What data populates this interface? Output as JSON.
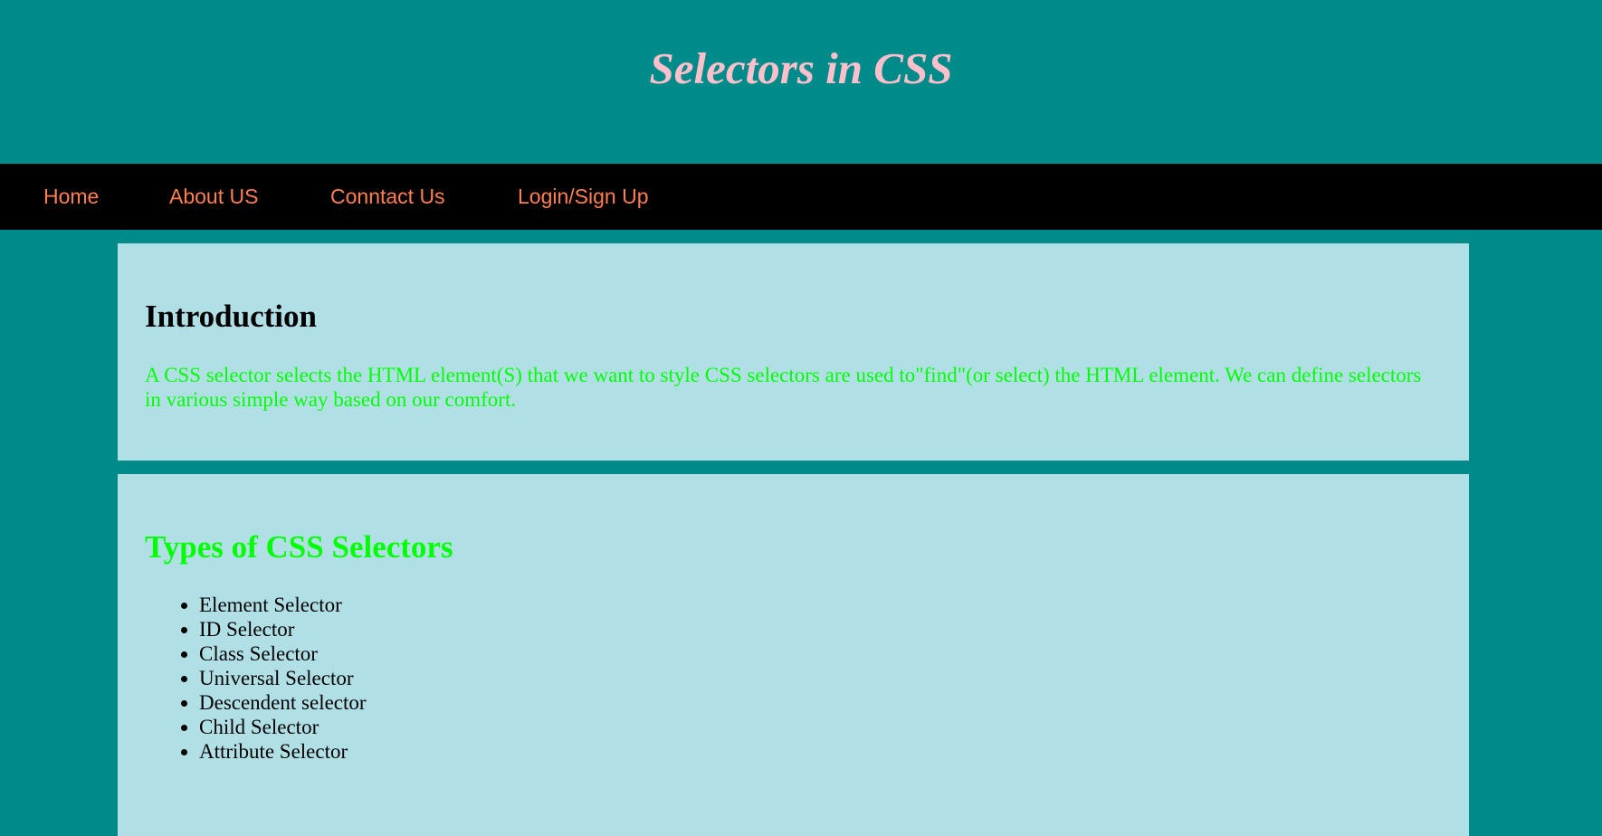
{
  "header": {
    "title": "Selectors in CSS"
  },
  "nav": {
    "items": [
      {
        "label": "Home"
      },
      {
        "label": "About US"
      },
      {
        "label": "Conntact Us"
      },
      {
        "label": "Login/Sign Up"
      }
    ]
  },
  "intro": {
    "heading": "Introduction",
    "text": "A CSS selector selects the HTML element(S) that we want to style CSS selectors are used to\"find\"(or select) the HTML element. We can define selectors in various simple way based on our comfort."
  },
  "types": {
    "heading": "Types of CSS Selectors",
    "items": [
      "Element Selector",
      "ID Selector",
      "Class Selector",
      "Universal Selector",
      "Descendent selector",
      "Child Selector",
      "Attribute Selector"
    ]
  },
  "colors": {
    "page_background": "#008B8B",
    "title": "#FFC0CB",
    "nav_background": "#000000",
    "nav_link": "#FF7F50",
    "card_background": "#B0E0E6",
    "accent_green": "#00FF00"
  }
}
